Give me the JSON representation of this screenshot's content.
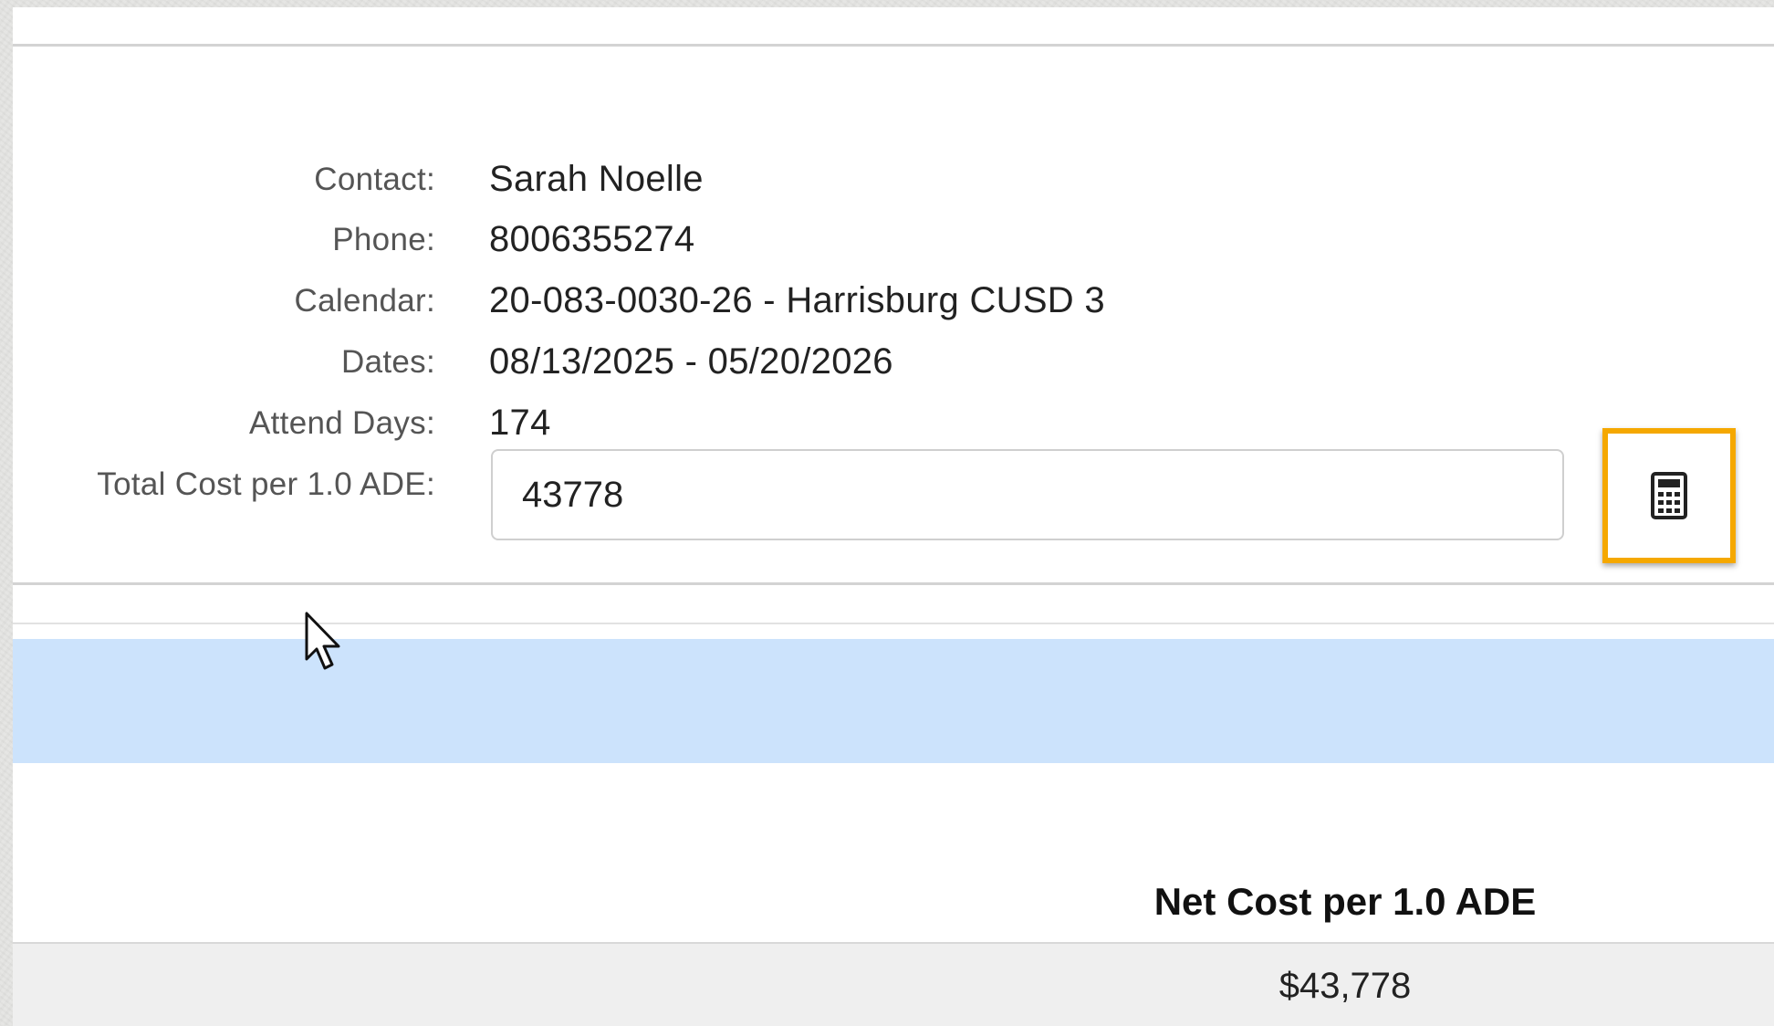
{
  "fields": [
    {
      "label": "Contact:",
      "value": "Sarah Noelle"
    },
    {
      "label": "Phone:",
      "value": "8006355274"
    },
    {
      "label": "Calendar:",
      "value": "20-083-0030-26 - Harrisburg CUSD 3"
    },
    {
      "label": "Dates:",
      "value": "08/13/2025 - 05/20/2026"
    },
    {
      "label": "Attend Days:",
      "value": "174"
    }
  ],
  "total_cost": {
    "label": "Total Cost per 1.0 ADE:",
    "value": "43778"
  },
  "calculator_button": {
    "icon": "calculator-icon",
    "highlight_color": "#f5a800"
  },
  "table": {
    "header": "Net Cost per 1.0 ADE",
    "rows": [
      {
        "net_cost": "$43,778"
      }
    ]
  },
  "colors": {
    "selection_band": "#cce3fc"
  }
}
